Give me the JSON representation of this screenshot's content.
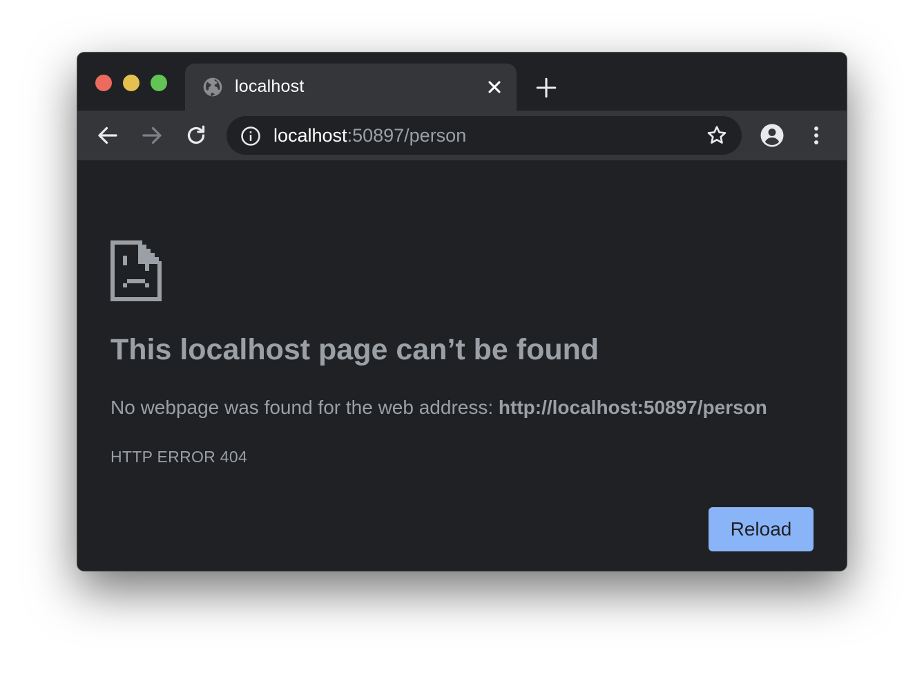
{
  "tab": {
    "title": "localhost",
    "close_icon": "close-icon",
    "favicon": "globe-icon"
  },
  "toolbar": {
    "back_icon": "arrow-left-icon",
    "forward_icon": "arrow-right-icon",
    "reload_icon": "reload-icon",
    "url_host": "localhost",
    "url_rest": ":50897/person",
    "info_icon": "info-icon",
    "star_icon": "star-icon",
    "profile_icon": "account-circle-icon",
    "menu_icon": "kebab-menu-icon"
  },
  "page": {
    "headline": "This localhost page can’t be found",
    "description_prefix": "No webpage was found for the web address: ",
    "description_url": "http://localhost:50897/person",
    "error_code": "HTTP ERROR 404",
    "reload_label": "Reload"
  },
  "colors": {
    "window_bg": "#202124",
    "toolbar_bg": "#35363a",
    "text_muted": "#9aa0a6",
    "accent": "#8ab4f8",
    "traffic_red": "#ed6a5e",
    "traffic_yellow": "#e5bf4f",
    "traffic_green": "#61c454"
  }
}
